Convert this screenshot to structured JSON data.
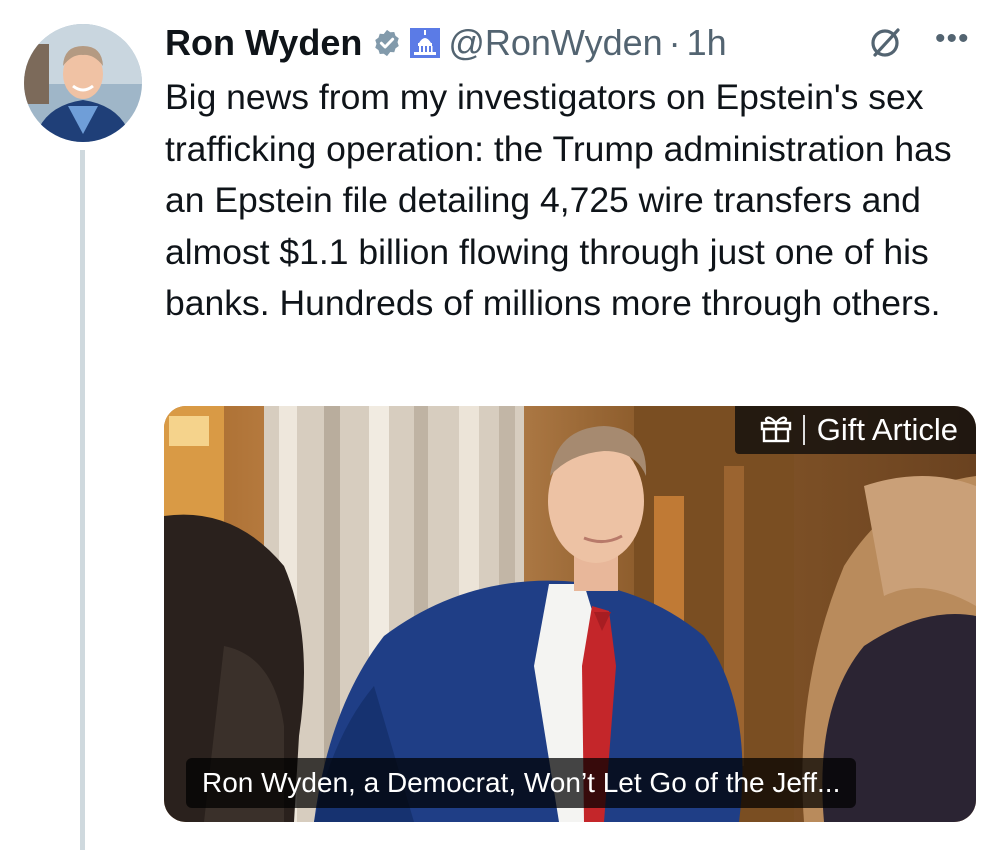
{
  "tweet": {
    "author_name": "Ron Wyden",
    "handle": "@RonWyden",
    "separator": "·",
    "time": "1h",
    "more_label": "•••",
    "text": "Big news from my investigators on Epstein's sex trafficking operation: the Trump administration has an Epstein file detailing 4,725 wire transfers and almost $1.1 billion flowing through just one of his banks. Hundreds of millions more through others."
  },
  "card": {
    "gift_label": "Gift Article",
    "caption": "Ron Wyden, a Democrat, Won’t Let Go of the Jeff..."
  },
  "colors": {
    "verified_badge": "#829aab",
    "secondary_text": "#536471",
    "thread_line": "#cfd9de"
  },
  "icons": [
    "verified-badge-icon",
    "capitol-icon",
    "grok-icon",
    "more-icon",
    "gift-icon"
  ]
}
